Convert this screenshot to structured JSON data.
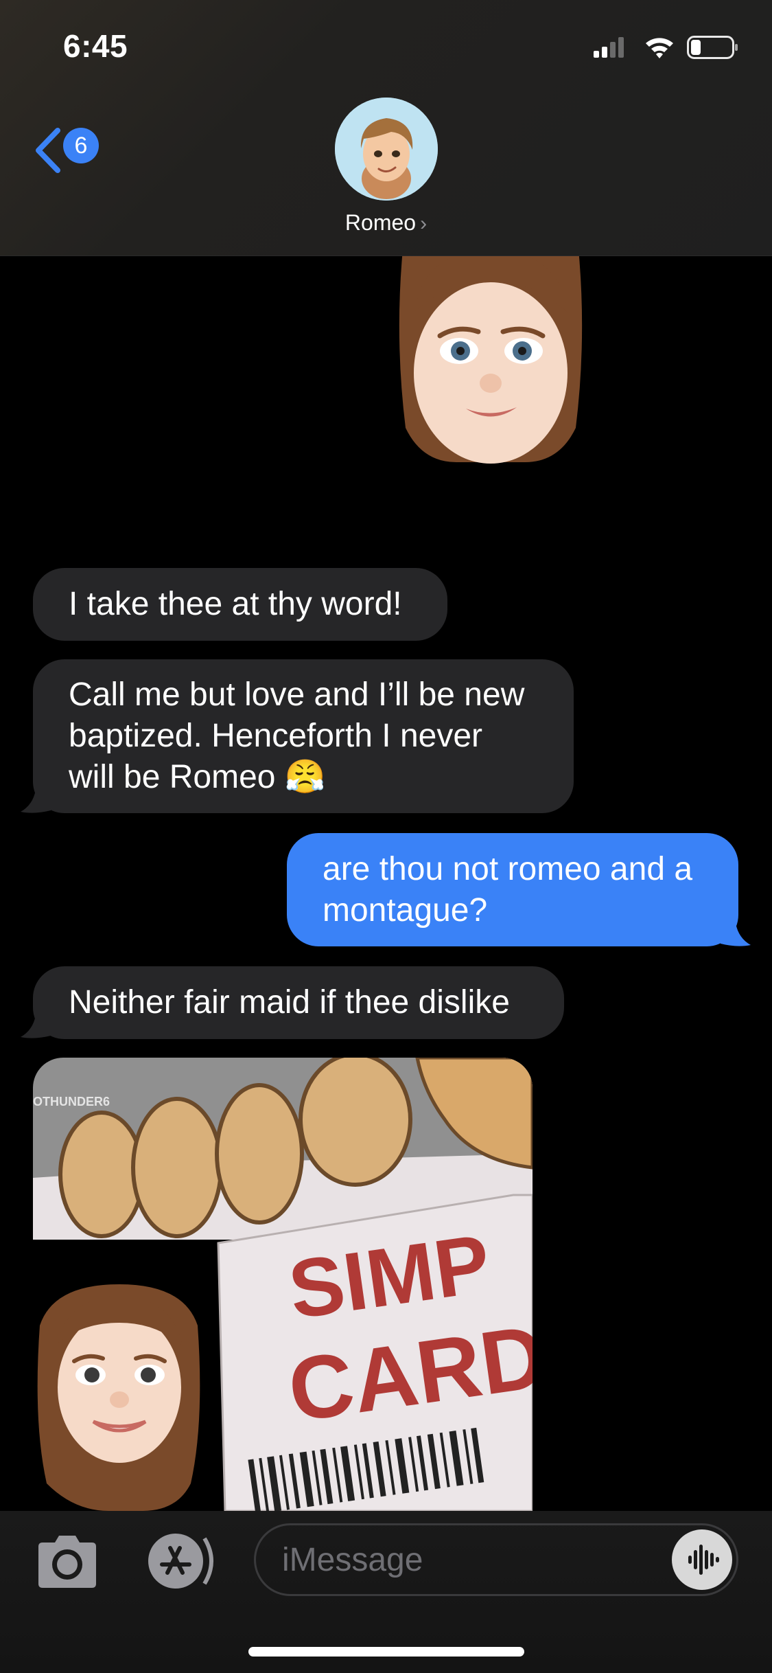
{
  "status_bar": {
    "time": "6:45"
  },
  "header": {
    "back_badge": "6",
    "contact_name": "Romeo",
    "contact_chevron": "›"
  },
  "messages": [
    {
      "from": "sent",
      "type": "memoji"
    },
    {
      "from": "received",
      "type": "text",
      "text": "I take thee at thy word!"
    },
    {
      "from": "received",
      "type": "text",
      "text": "Call me but love and I’ll be new\nbaptized. Henceforth I never\nwill be Romeo",
      "emoji": "😤"
    },
    {
      "from": "sent",
      "type": "text",
      "text": "are thou not romeo and a\nmontague?"
    },
    {
      "from": "received",
      "type": "text",
      "text": "Neither fair maid if thee dislike"
    },
    {
      "from": "received",
      "type": "image",
      "watermark": "OTHUNDER6",
      "card_line1": "SIMP",
      "card_line2": "CARD"
    }
  ],
  "input": {
    "placeholder": "iMessage"
  },
  "icons": {
    "back": "chevron-left-icon",
    "camera": "camera-icon",
    "apps": "app-store-icon",
    "audio": "waveform-icon",
    "signal": "signal-icon",
    "wifi": "wifi-icon",
    "battery": "battery-icon"
  },
  "colors": {
    "sent_bubble": "#3a82f7",
    "received_bubble": "#262628",
    "badge": "#3b82f6"
  }
}
